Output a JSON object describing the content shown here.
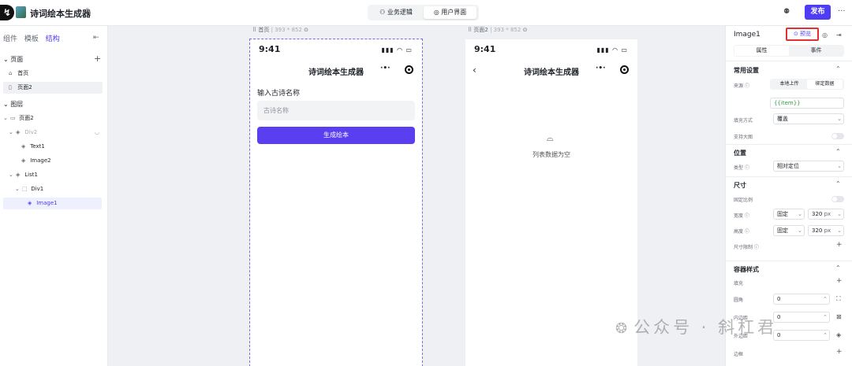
{
  "header": {
    "app_title": "诗词绘本生成器",
    "tabs": [
      {
        "label": "业务逻辑",
        "icon": "logic-icon"
      },
      {
        "label": "用户界面",
        "icon": "palette-icon"
      }
    ],
    "publish_label": "发布",
    "accent": "#4f3df5"
  },
  "left_panel": {
    "tabs": [
      "组件",
      "模板",
      "结构"
    ],
    "pages_label": "页面",
    "pages": [
      "首页",
      "页面2"
    ],
    "layers_label": "图层",
    "tree": [
      "页面2",
      "Div2",
      "Text1",
      "Image2",
      "List1",
      "Div1",
      "Image1"
    ]
  },
  "canvas": {
    "page1": {
      "name": "首页",
      "size": "393 * 852",
      "time": "9:41",
      "title": "诗词绘本生成器",
      "field_label": "输入古诗名称",
      "placeholder": "古诗名称",
      "button_label": "生成绘本"
    },
    "page2": {
      "name": "页面2",
      "size": "393 * 852",
      "time": "9:41",
      "title": "诗词绘本生成器",
      "empty_text": "列表数据为空"
    }
  },
  "right_panel": {
    "component_name": "Image1",
    "preview_label": "预览",
    "tabs": [
      "属性",
      "事件"
    ],
    "common_section": "常用设置",
    "source_label": "来源",
    "source_options": [
      "本地上传",
      "绑定数据"
    ],
    "source_value": "{{item}}",
    "fill_label": "填充方式",
    "fill_value": "覆盖",
    "bigimg_label": "支持大图",
    "position_section": "位置",
    "type_label": "类型",
    "type_value": "相对定位",
    "size_section": "尺寸",
    "fixed_ratio_label": "固定比例",
    "width_label": "宽度",
    "width_mode": "固定",
    "width_value": "320",
    "width_unit": "px",
    "height_label": "高度",
    "height_mode": "固定",
    "height_value": "320",
    "height_unit": "px",
    "size_limit_label": "尺寸限制",
    "style_section": "容器样式",
    "fill2_label": "填充",
    "radius_label": "圆角",
    "radius_value": "0",
    "padding_label": "内边距",
    "padding_value": "0",
    "margin_label": "外边距",
    "margin_value": "0",
    "border_label": "边框"
  },
  "watermark": "公众号 · 斜杠君"
}
